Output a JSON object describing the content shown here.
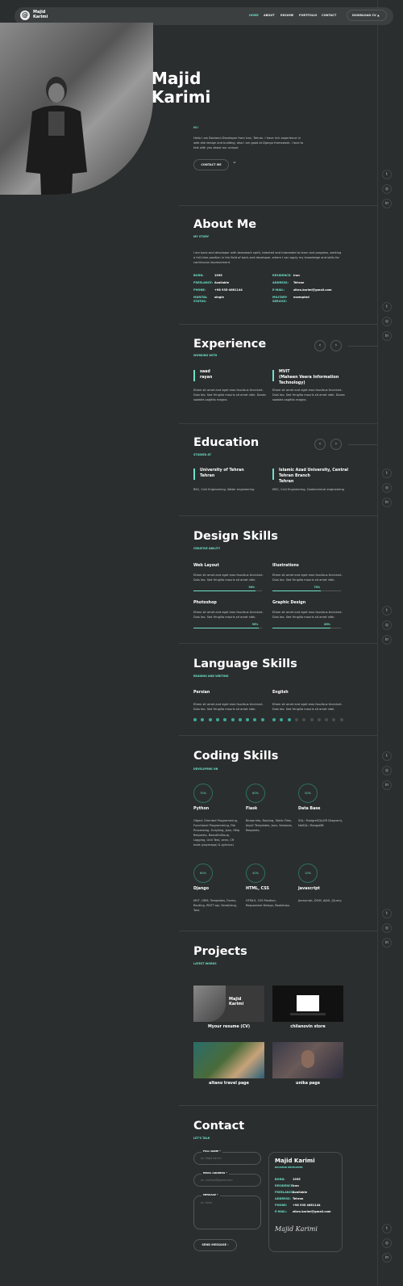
{
  "brand": {
    "line1": "Majid",
    "line2": "Karimi",
    "mark": "@"
  },
  "nav": {
    "items": [
      "HOME",
      "ABOUT",
      "RESUME",
      "PORTFOLIO",
      "CONTACT"
    ],
    "download": "DOWNLOAD CV"
  },
  "hero": {
    "first": "Majid",
    "last": "Karimi",
    "greeting": "Hi !",
    "intro": "Hello I am Backend Developer from Iran, Tehran. I have rich experience in web site design and building, also I am good at Django framework. I love to talk with you about our unique.",
    "cta": "CONTACT ME"
  },
  "about": {
    "title": "About Me",
    "subtitle": "MY STORY",
    "text": "I am back-end developer with teamwork spirit, talented and interested to learn and progress, seeking a full-time position in the field of back-end developer, where I can apply my knowledge and skills for continuous improvement.",
    "left": [
      {
        "k": "BORN:",
        "v": "1995"
      },
      {
        "k": "FREELANCE:",
        "v": "Available"
      },
      {
        "k": "PHONE:",
        "v": "+98 935-4661144"
      },
      {
        "k": "MARITAL STATUS:",
        "v": "single"
      }
    ],
    "right": [
      {
        "k": "RESIDENCE:",
        "v": "Iran"
      },
      {
        "k": "ADDRESS:",
        "v": "Tehran"
      },
      {
        "k": "E-MAIL:",
        "v": "zibro.karimi@gmail.com"
      },
      {
        "k": "MILITARY SERVICE:",
        "v": "exempted"
      }
    ]
  },
  "experience": {
    "title": "Experience",
    "subtitle": "WORKING WITH",
    "items": [
      {
        "title": "saad\nrayan",
        "text": "Etiam sit amet and eget eros faucibus tincidunt. Duis leo. Sed fringilla mauris sit amet nibh. Donec sodales sagittis magna."
      },
      {
        "title": "MVIT\n(Maheen Veera Information Technology)",
        "text": "Etiam sit amet and eget eros faucibus tincidunt. Duis leo. Sed fringilla mauris sit amet nibh. Donec sodales sagittis magna."
      }
    ]
  },
  "education": {
    "title": "Education",
    "subtitle": "STUDIED AT",
    "items": [
      {
        "title": "University of Tehran\nTehran",
        "text": "BSC, Civil Engineering, Water engineering"
      },
      {
        "title": "Islamic Azad University, Central Tehran Branch\nTehran",
        "text": "MSC, Civil Engineering, Geotechnical engineering"
      }
    ]
  },
  "design": {
    "title": "Design Skills",
    "subtitle": "CREATIVE ABILITY",
    "items": [
      {
        "name": "Web Layout",
        "text": "Etiam sit amet and eget eros faucibus tincidunt. Duis leo. Sed fringilla mauris sit amet nibh.",
        "pct": "90%",
        "v": 0.9
      },
      {
        "name": "Illustrations",
        "text": "Etiam sit amet and eget eros faucibus tincidunt. Duis leo. Sed fringilla mauris sit amet nibh.",
        "pct": "70%",
        "v": 0.7
      },
      {
        "name": "Photoshop",
        "text": "Etiam sit amet and eget eros faucibus tincidunt. Duis leo. Sed fringilla mauris sit amet nibh.",
        "pct": "95%",
        "v": 0.95
      },
      {
        "name": "Graphic Design",
        "text": "Etiam sit amet and eget eros faucibus tincidunt. Duis leo. Sed fringilla mauris sit amet nibh.",
        "pct": "85%",
        "v": 0.85
      }
    ]
  },
  "language": {
    "title": "Language Skills",
    "subtitle": "READING AND WRITING",
    "items": [
      {
        "name": "Persian",
        "text": "Etiam sit amet and eget eros faucibus tincidunt. Duis leo. Sed fringilla mauris sit amet nibh.",
        "level": 10
      },
      {
        "name": "English",
        "text": "Etiam sit amet and eget eros faucibus tincidunt. Duis leo. Sed fringilla mauris sit amet nibh.",
        "level": 3
      }
    ]
  },
  "coding": {
    "title": "Coding Skills",
    "subtitle": "DEVELOPING ON",
    "items": [
      {
        "pct": "70%",
        "name": "Python",
        "text": "Object Oriented Programming, Functional Programming, File Processing, Scripting, Json, Http Requests, BeautifulSoup, Logging, Unit Test, venv, CR tools (paymapp) & pyinvoc)"
      },
      {
        "pct": "60%",
        "name": "Flask",
        "text": "Blueprints, Routing, Static Files, Jinja2 Templates, Json, Sessions, Requests."
      },
      {
        "pct": "50%",
        "name": "Data Base",
        "text": "SQL: PostgreSQL(ER Diagram), NoSQL: MongoDB"
      },
      {
        "pct": "60%",
        "name": "Django",
        "text": "MVT, ORM, Templates, Forms, Routing, REST api, Serializing, Test."
      },
      {
        "pct": "40%",
        "name": "HTML, CSS",
        "text": "HTML5, CSS Position, Responsive Design, Bootstrap."
      },
      {
        "pct": "10%",
        "name": "Javascript",
        "text": "Javascript, DOM, AJAX, JQuery."
      }
    ]
  },
  "projects": {
    "title": "Projects",
    "subtitle": "LATEST WORKS",
    "items": [
      "Myour resume (CV)",
      "chilanovin store",
      "altano travel page",
      "unika page"
    ]
  },
  "contact": {
    "title": "Contact",
    "subtitle": "LET'S TALK",
    "fields": [
      {
        "label": "FULL NAME *",
        "ph": "ex. Majid Karimi"
      },
      {
        "label": "EMAIL ADDRESS *",
        "ph": "ex. myemail@gmail.com"
      },
      {
        "label": "MESSAGE *",
        "ph": "ex. Hello"
      }
    ],
    "send": "SEND MESSAGE",
    "card": {
      "name": "Majid Karimi",
      "role": "BACKEND DEVELOPER",
      "rows": [
        {
          "k": "BORN:",
          "v": "1995"
        },
        {
          "k": "RESIDENCE:",
          "v": "Iran"
        },
        {
          "k": "FREELANCE:",
          "v": "Available"
        },
        {
          "k": "ADDRESS:",
          "v": "Tehran"
        },
        {
          "k": "PHONE:",
          "v": "+98 935 4661144"
        },
        {
          "k": "E-MAIL:",
          "v": "zibro.karimi@gmail.com"
        }
      ],
      "signature": "Majid Karimi"
    }
  },
  "social": [
    "twitter-icon",
    "github-icon",
    "linkedin-icon"
  ],
  "colors": {
    "bg": "#2b2e2e",
    "accent": "#6de0cb"
  }
}
